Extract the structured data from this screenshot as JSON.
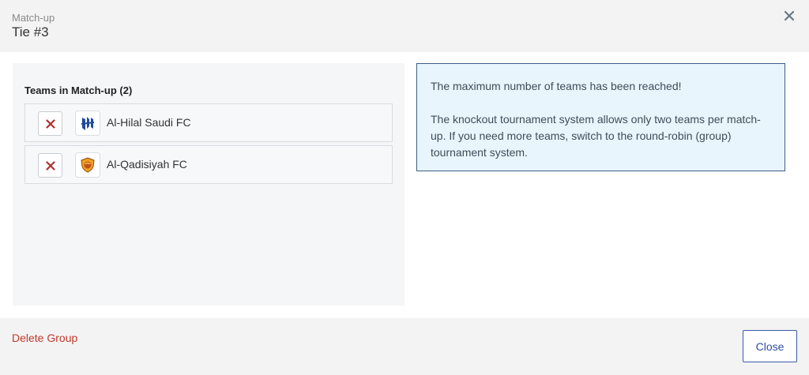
{
  "header": {
    "subtitle": "Match-up",
    "title": "Tie #3",
    "close_icon": "close-icon"
  },
  "teams": {
    "heading": "Teams in Match-up (2)",
    "items": [
      {
        "name": "Al-Hilal Saudi FC",
        "logo_icon": "al-hilal-logo-icon",
        "remove_icon": "close-icon"
      },
      {
        "name": "Al-Qadisiyah FC",
        "logo_icon": "al-qadisiyah-logo-icon",
        "remove_icon": "close-icon"
      }
    ]
  },
  "info": {
    "line1": "The maximum number of teams has been reached!",
    "line2": "The knockout tournament system allows only two teams per match-up. If you need more teams, switch to the round-robin (group) tournament system."
  },
  "footer": {
    "delete_label": "Delete Group",
    "close_label": "Close"
  },
  "colors": {
    "danger": "#c0392b",
    "primary": "#2f4f9e",
    "info_bg": "#e8f5fd",
    "info_border": "#3b5e86"
  }
}
